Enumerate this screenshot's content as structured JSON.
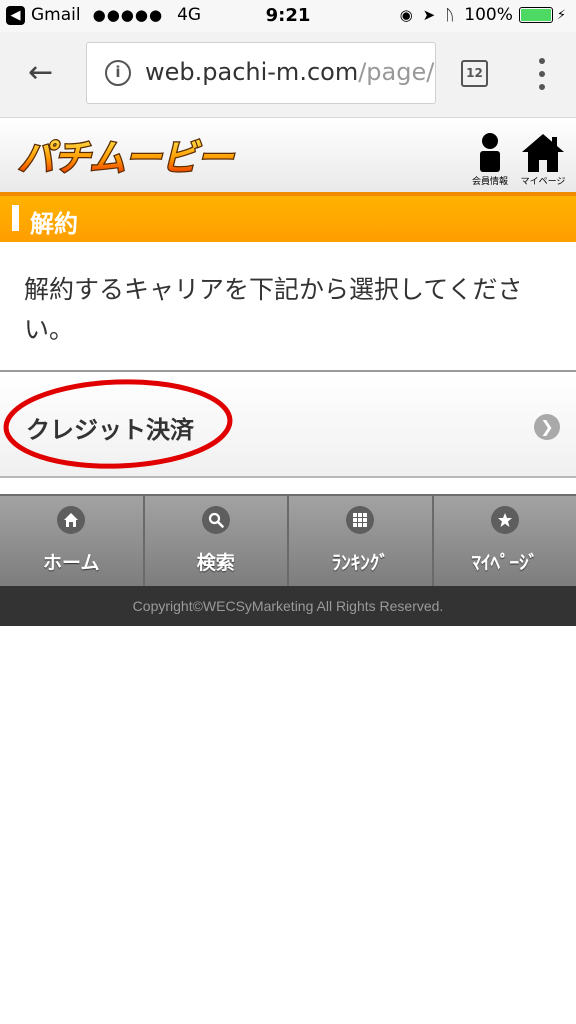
{
  "status_bar": {
    "back_app": "Gmail",
    "signal": "●●●●●",
    "network": "4G",
    "time": "9:21",
    "battery": "100%"
  },
  "browser": {
    "url_domain": "web.pachi-m.com",
    "url_path": "/page/n",
    "tab_count": "12"
  },
  "header": {
    "logo_text": "パチムービー",
    "member_label": "会員情報",
    "mypage_label": "マイページ"
  },
  "section": {
    "title": "解約"
  },
  "instruction": "解約するキャリアを下記から選択してください。",
  "carriers": [
    {
      "label": "クレジット決済"
    }
  ],
  "bottom_nav": [
    {
      "label": "ホーム",
      "icon": "home-icon"
    },
    {
      "label": "検索",
      "icon": "search-icon"
    },
    {
      "label": "ﾗﾝｷﾝｸﾞ",
      "icon": "grid-icon"
    },
    {
      "label": "ﾏｲﾍﾟｰｼﾞ",
      "icon": "star-icon"
    }
  ],
  "footer": {
    "copyright": "Copyright©WECSyMarketing All Rights Reserved."
  },
  "colors": {
    "accent_orange": "#ff9e00",
    "highlight_red": "#e00000",
    "footer_bg": "#333333"
  }
}
